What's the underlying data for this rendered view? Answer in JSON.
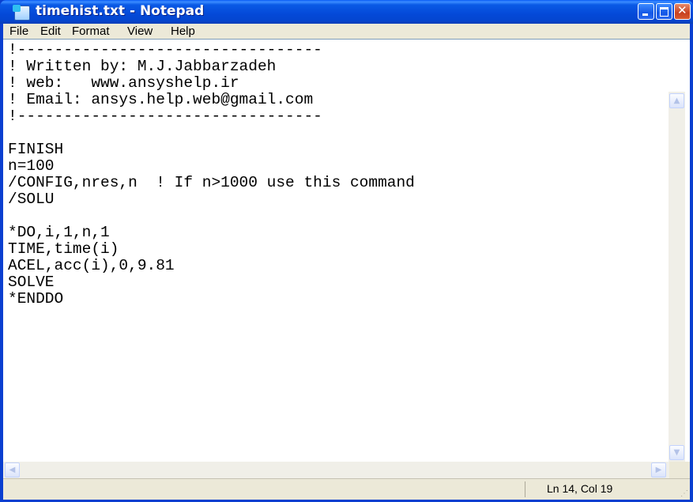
{
  "window": {
    "title": "timehist.txt - Notepad"
  },
  "menu": [
    "File",
    "Edit",
    "Format",
    "View",
    "Help"
  ],
  "editor": {
    "content": "!---------------------------------\n! Written by: M.J.Jabbarzadeh\n! web:   www.ansyshelp.ir\n! Email: ansys.help.web@gmail.com\n!---------------------------------\n\nFINISH\nn=100\n/CONFIG,nres,n  ! If n>1000 use this command\n/SOLU\n\n*DO,i,1,n,1\nTIME,time(i)\nACEL,acc(i),0,9.81\nSOLVE\n*ENDDO"
  },
  "status": {
    "cursor_position": "Ln 14, Col 19"
  },
  "icons": {
    "app": "notepad-icon",
    "minimize": "minimize-icon",
    "maximize": "maximize-icon",
    "close": "close-icon",
    "scroll_up": "scroll-up-arrow-icon",
    "scroll_down": "scroll-down-arrow-icon",
    "scroll_left": "scroll-left-arrow-icon",
    "scroll_right": "scroll-right-arrow-icon",
    "resize_grip": "resize-grip-icon"
  },
  "colors": {
    "titlebar": "#0449d8",
    "close_button": "#c84020",
    "menubar": "#ece9d8"
  }
}
